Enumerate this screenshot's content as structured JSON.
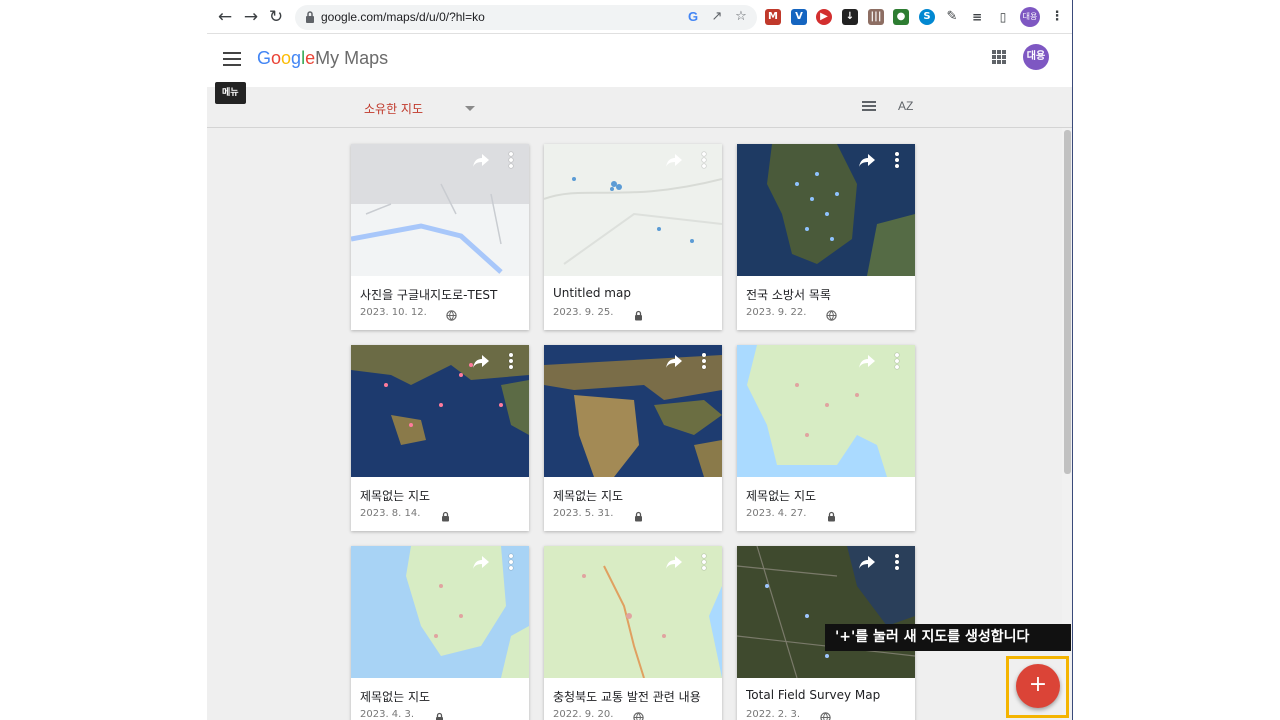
{
  "browser": {
    "url": "google.com/maps/d/u/0/?hl=ko",
    "profile_initials": "대용"
  },
  "app": {
    "logo_google": [
      "G",
      "o",
      "o",
      "g",
      "l",
      "e"
    ],
    "logo_product": "My Maps",
    "avatar_initials": "대용",
    "menu_tooltip": "메뉴"
  },
  "toolbar": {
    "filter_label": "소유한 지도",
    "sort_label": "AZ"
  },
  "maps": [
    {
      "title": "사진을 구글내지도로-TEST",
      "date": "2023. 10. 12.",
      "visibility": "public",
      "thumb": "light-map"
    },
    {
      "title": "Untitled map",
      "date": "2023. 9. 25.",
      "visibility": "private",
      "thumb": "light-map-dots"
    },
    {
      "title": "전국 소방서 목록",
      "date": "2023. 9. 22.",
      "visibility": "public",
      "thumb": "satellite-korea"
    },
    {
      "title": "제목없는 지도",
      "date": "2023. 8. 14.",
      "visibility": "private",
      "thumb": "satellite-world-pacific"
    },
    {
      "title": "제목없는 지도",
      "date": "2023. 5. 31.",
      "visibility": "private",
      "thumb": "satellite-world-africa"
    },
    {
      "title": "제목없는 지도",
      "date": "2023. 4. 27.",
      "visibility": "private",
      "thumb": "terrain-korea"
    },
    {
      "title": "제목없는 지도",
      "date": "2023. 4. 3.",
      "visibility": "private",
      "thumb": "terrain-korea-west"
    },
    {
      "title": "충청북도 교통 발전 관련 내용",
      "date": "2022. 9. 20.",
      "visibility": "public",
      "thumb": "terrain-korea-close"
    },
    {
      "title": "Total Field Survey Map",
      "date": "2022. 2. 3.",
      "visibility": "public",
      "thumb": "satellite-coast"
    }
  ],
  "callout": {
    "text": "'+'를 눌러 새 지도를 생성합니다"
  },
  "fab": {
    "label": "+"
  },
  "colors": {
    "accent_red": "#db4437",
    "highlight_yellow": "#f4b400",
    "avatar_purple": "#7e57c2"
  }
}
